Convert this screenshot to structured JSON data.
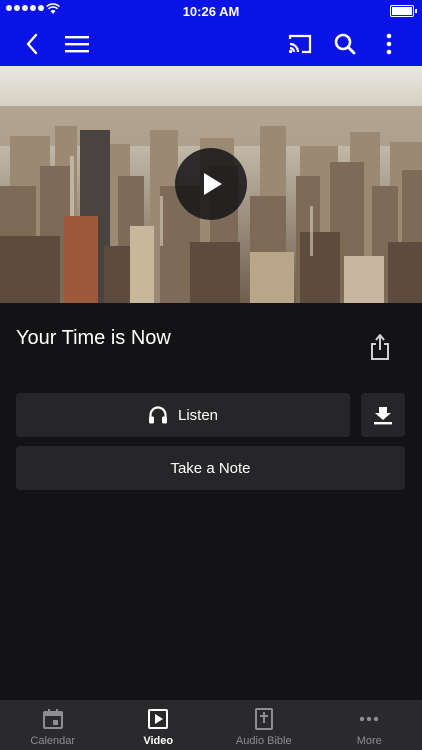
{
  "status_bar": {
    "time": "10:26 AM"
  },
  "header": {
    "back_icon": "chevron-left-icon",
    "menu_icon": "hamburger-menu-icon",
    "cast_icon": "cast-icon",
    "search_icon": "search-icon",
    "more_icon": "vertical-dots-icon"
  },
  "video": {
    "play_icon": "play-icon"
  },
  "content": {
    "title": "Your Time is Now",
    "listen_label": "Listen",
    "take_note_label": "Take a Note"
  },
  "tab_bar": {
    "items": [
      {
        "label": "Calendar",
        "icon": "calendar-icon"
      },
      {
        "label": "Video",
        "icon": "video-play-icon"
      },
      {
        "label": "Audio Bible",
        "icon": "bible-icon"
      },
      {
        "label": "More",
        "icon": "more-dots-icon"
      }
    ],
    "active": "Video"
  },
  "colors": {
    "header_bg": "#0b14e6",
    "page_bg": "#131315",
    "button_bg": "#262628",
    "tab_bar_bg": "#2a2a2c"
  }
}
